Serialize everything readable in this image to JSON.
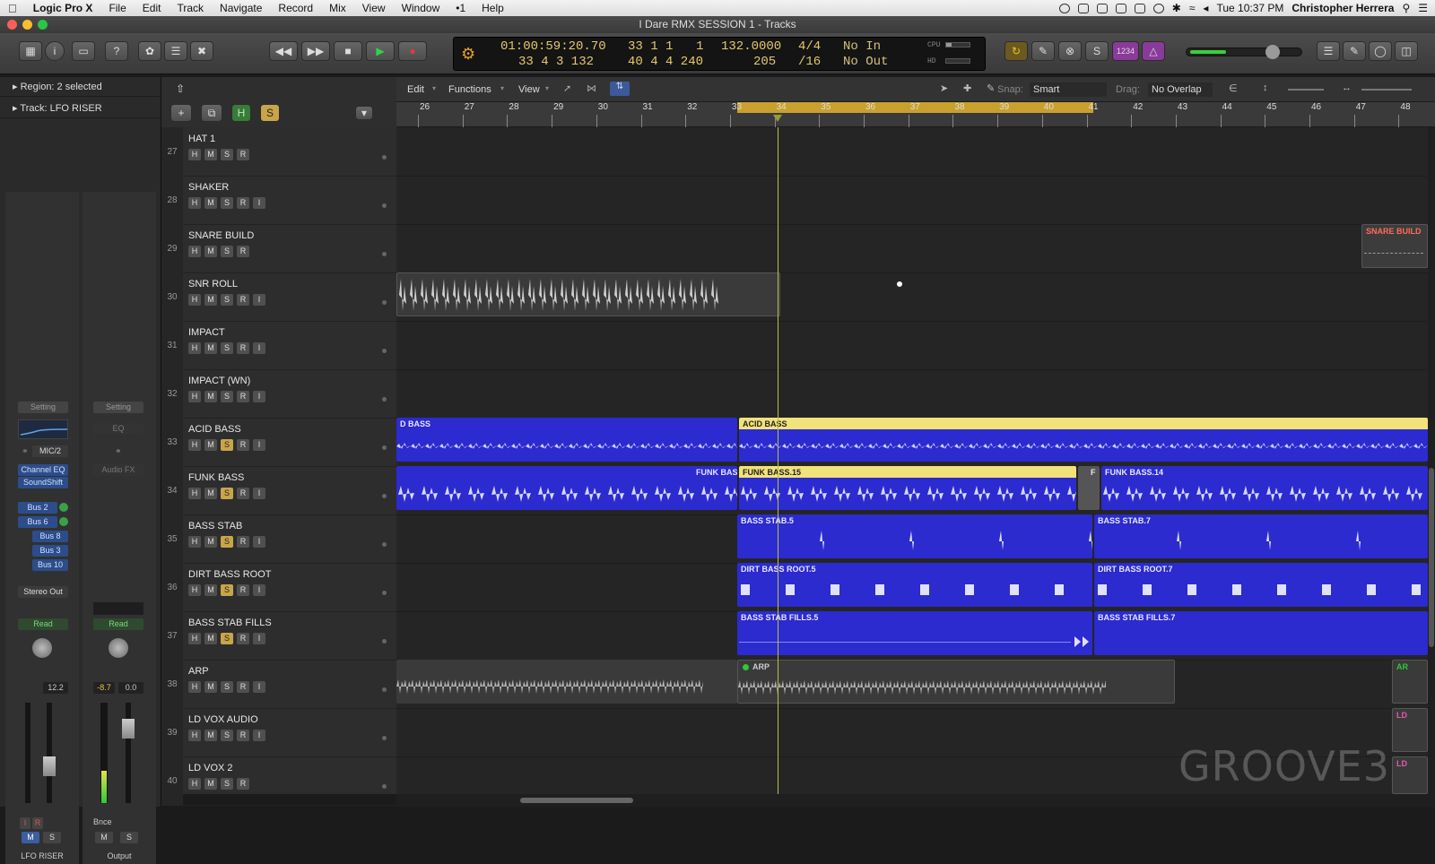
{
  "menubar": {
    "app": "Logic Pro X",
    "items": [
      "File",
      "Edit",
      "Track",
      "Navigate",
      "Record",
      "Mix",
      "View",
      "Window",
      "•1",
      "Help"
    ],
    "clock": "Tue 10:37 PM",
    "user": "Christopher Herrera"
  },
  "window": {
    "title": "I Dare RMX SESSION 1 - Tracks"
  },
  "lcd": {
    "time": "01:00:59:20.70",
    "bar_top": "33  1  1",
    "beat_top": "1",
    "tempo": "132.0000",
    "sig_top": "4/4",
    "in": "No In",
    "bar_bottom": "33  4  3  132",
    "pos_bottom": "40  4  4  240",
    "tempo_bottom": "205",
    "sig_bottom": "/16",
    "out": "No Out",
    "cpu": "CPU",
    "hd": "HD"
  },
  "toolbar": {
    "count_in": "1234"
  },
  "inspector": {
    "region": "Region: 2 selected",
    "track": "Track:  LFO RISER",
    "setting_label": "Setting",
    "eq_label": "EQ",
    "input": "MIC/2",
    "plugins": [
      "Channel EQ",
      "SoundShift"
    ],
    "audio_fx": "Audio FX",
    "sends": [
      "Bus 2",
      "Bus 6",
      "Bus 8",
      "Bus 3",
      "Bus 10"
    ],
    "stereo_out": "Stereo Out",
    "read1": "Read",
    "read2": "Read",
    "val1": "12.2",
    "val2": "-8.7",
    "val3": "0.0",
    "bnce": "Bnce",
    "strip1_name": "LFO RISER",
    "strip2_name": "Output",
    "ir_i": "I",
    "ir_r": "R",
    "m": "M",
    "s": "S"
  },
  "editbar": {
    "menus": [
      "Edit",
      "Functions",
      "View"
    ],
    "snap_label": "Snap:",
    "snap_value": "Smart",
    "drag_label": "Drag:",
    "drag_value": "No Overlap"
  },
  "trackhdr": {
    "h": "H",
    "s": "S"
  },
  "ruler": {
    "bars": [
      "26",
      "27",
      "28",
      "29",
      "30",
      "31",
      "32",
      "33",
      "34",
      "35",
      "36",
      "37",
      "38",
      "39",
      "40",
      "41",
      "42",
      "43",
      "44",
      "45",
      "46",
      "47",
      "48"
    ]
  },
  "tracks": [
    {
      "num": "27",
      "name": "HAT 1",
      "solo": false,
      "i": false
    },
    {
      "num": "28",
      "name": "SHAKER",
      "solo": false,
      "i": true
    },
    {
      "num": "29",
      "name": "SNARE BUILD",
      "solo": false,
      "i": false
    },
    {
      "num": "30",
      "name": "SNR ROLL",
      "solo": false,
      "i": true
    },
    {
      "num": "31",
      "name": "IMPACT",
      "solo": false,
      "i": true
    },
    {
      "num": "32",
      "name": "IMPACT (WN)",
      "solo": false,
      "i": true
    },
    {
      "num": "33",
      "name": "ACID BASS",
      "solo": true,
      "i": true
    },
    {
      "num": "34",
      "name": "FUNK BASS",
      "solo": true,
      "i": true
    },
    {
      "num": "35",
      "name": "BASS STAB",
      "solo": true,
      "i": true
    },
    {
      "num": "36",
      "name": "DIRT BASS ROOT",
      "solo": true,
      "i": true
    },
    {
      "num": "37",
      "name": "BASS STAB FILLS",
      "solo": true,
      "i": true
    },
    {
      "num": "38",
      "name": "ARP",
      "solo": false,
      "i": true
    },
    {
      "num": "39",
      "name": "LD VOX AUDIO",
      "solo": false,
      "i": true
    },
    {
      "num": "40",
      "name": "LD VOX 2",
      "solo": false,
      "i": false
    }
  ],
  "track_buttons": {
    "h": "H",
    "m": "M",
    "s": "S",
    "r": "R",
    "i": "I"
  },
  "regions": {
    "snare_build": "SNARE BUILD",
    "acid_left": "D BASS",
    "acid_right": "ACID BASS",
    "funk_left": "FUNK BAS",
    "funk_mid": "FUNK BASS.15",
    "funk_small": "F",
    "funk_right": "FUNK BASS.14",
    "stab_a": "BASS STAB.5",
    "stab_b": "BASS STAB.7",
    "dirt_a": "DIRT BASS ROOT.5",
    "dirt_b": "DIRT BASS ROOT.7",
    "fills_a": "BASS STAB FILLS.5",
    "fills_b": "BASS STAB FILLS.7",
    "arp": "ARP",
    "arp_edge": "AR",
    "ld1": "LD",
    "ld2": "LD"
  },
  "colors": {
    "audio_blue": "#2b2bd0",
    "selected_yellow": "#f2e27a",
    "cycle": "#c9a02e",
    "grey_region": "#3d3d3d"
  },
  "watermark": "GROOVE3"
}
